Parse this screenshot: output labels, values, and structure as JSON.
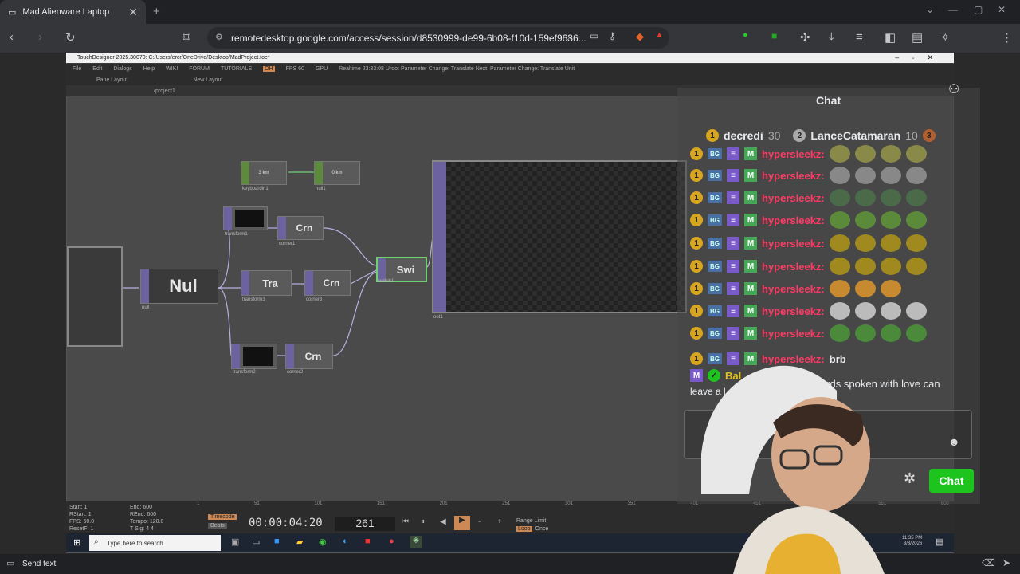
{
  "browser": {
    "tab_title": "Mad Alienware Laptop",
    "url": "remotedesktop.google.com/access/session/d8530999-de99-6b08-f10d-159ef9636..."
  },
  "td": {
    "title": "TouchDesigner 2025.30070: C:/Users/ercr/OneDrive/Desktop/MadProject.toe*",
    "menu": [
      "File",
      "Edit",
      "Dialogs",
      "Help",
      "WIKI",
      "FORUM",
      "TUTORIALS",
      "OH",
      "FPS 60",
      "GPU"
    ],
    "realtime": "Realtime  23:33:08 Urdo: Parameter Change: Translate  Next: Parameter Change: Translate Unit",
    "pane_layout": "Pane Layout",
    "new_layout": "New Layout",
    "path": "/project1",
    "nodes": {
      "keyboard": {
        "text": "3 km",
        "label": "keyboardin1"
      },
      "null1": {
        "text": "0 km",
        "label": "null1"
      },
      "transform1_label": "transform1",
      "crn1": {
        "text": "Crn",
        "label": "corner1"
      },
      "nul": {
        "text": "Nul",
        "label": "null"
      },
      "tra": {
        "text": "Tra",
        "label": "transform3"
      },
      "crn3": {
        "text": "Crn",
        "label": "corner3"
      },
      "swi": {
        "text": "Swi",
        "label": "switch1"
      },
      "transform2_label": "transform2",
      "crn2": {
        "text": "Crn",
        "label": "corner2"
      },
      "out": {
        "label": "out1"
      }
    },
    "bottom": {
      "start": "Start:  1",
      "end": "End:  600",
      "rstart": "RStart:  1",
      "rend": "REnd:  600",
      "fps": "FPS:  60.0",
      "tempo": "Tempo:  120.0",
      "resetf": "ResetF:  1",
      "tsig": "T Sig:  4   4",
      "timecode_label": "Timecode",
      "beats_label": "Beats",
      "timecode": "00:00:04:20",
      "frame": "261",
      "range_limit": "Range Limit",
      "loop": "Loop",
      "once": "Once",
      "ticks": [
        "1",
        "51",
        "101",
        "151",
        "201",
        "251",
        "301",
        "351",
        "401",
        "451",
        "501",
        "551",
        "600"
      ]
    }
  },
  "taskbar": {
    "search_placeholder": "Type here to search",
    "time": "11:35 PM",
    "date": "8/3/2026"
  },
  "send_text": "Send text",
  "chat": {
    "header": "Chat",
    "top_user1": "decredi",
    "top_user1_score": "30",
    "top_user2": "LanceCatamaran",
    "top_user2_score": "10",
    "rank3": "3",
    "rows": [
      {
        "user": "hypersleekz:",
        "msg": ""
      },
      {
        "user": "hypersleekz:",
        "msg": ""
      },
      {
        "user": "hypersleekz:",
        "msg": ""
      },
      {
        "user": "hypersleekz:",
        "msg": ""
      },
      {
        "user": "hypersleekz:",
        "msg": ""
      },
      {
        "user": "hypersleekz:",
        "msg": ""
      },
      {
        "user": "hypersleekz:",
        "msg": ""
      },
      {
        "user": "hypersleekz:",
        "msg": ""
      },
      {
        "user": "hypersleekz:",
        "msg": ""
      },
      {
        "user": "hypersleekz:",
        "msg": "brb"
      }
    ],
    "last_user": "Bal",
    "last_msg_a": "ords spoken with love can",
    "last_msg_b": "leave a l",
    "chat_button": "Chat"
  },
  "colors": {
    "accent_green": "#1ec41e",
    "username_red": "#ff3b66",
    "node_purple": "#6c62a0"
  }
}
